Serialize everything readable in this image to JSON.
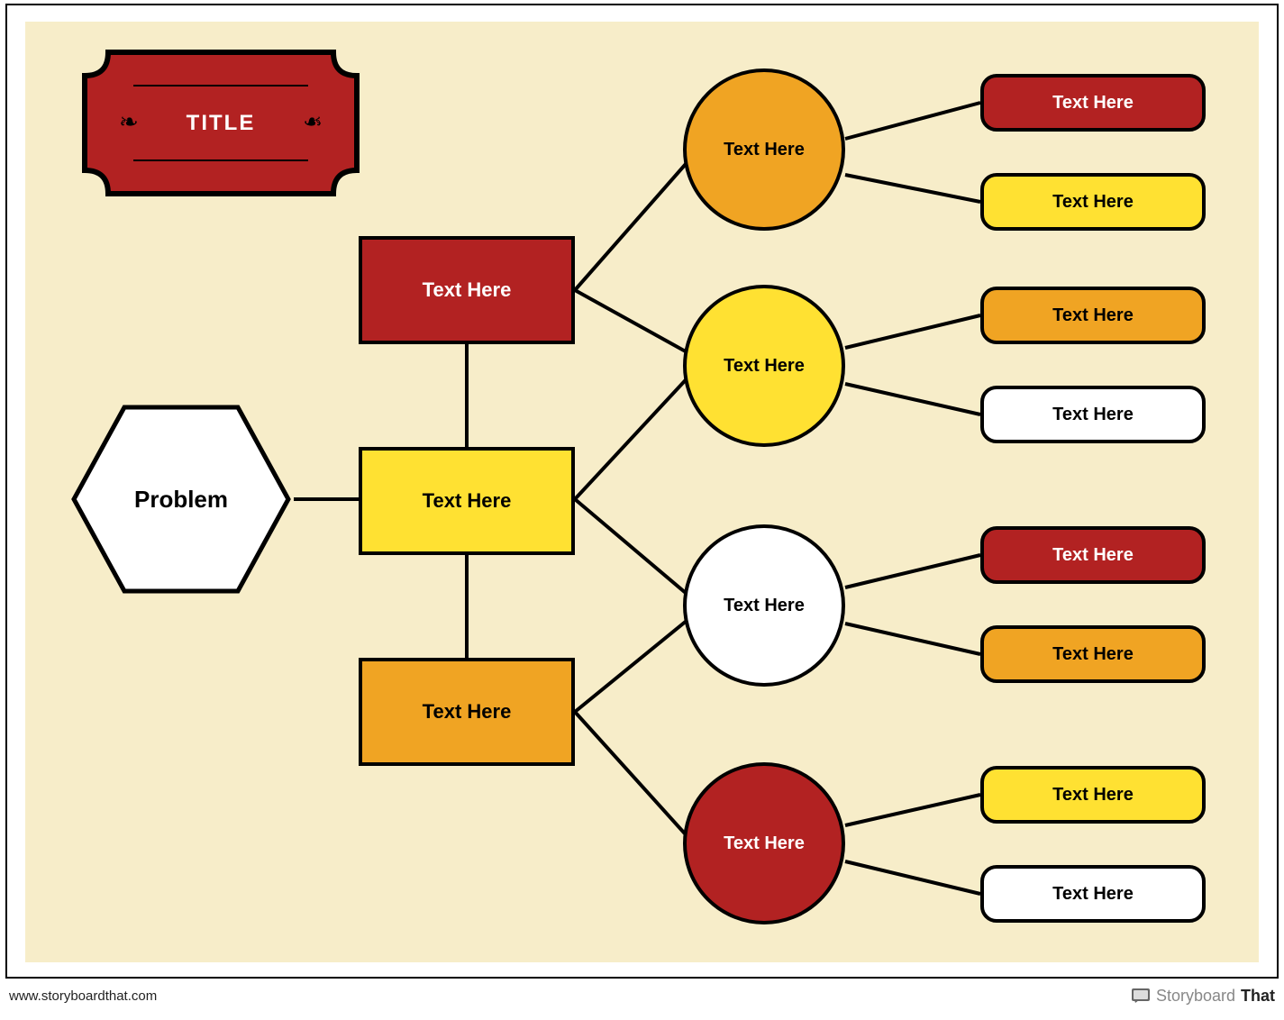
{
  "title": {
    "text": "TITLE"
  },
  "root": {
    "label": "Problem"
  },
  "branches": [
    {
      "label": "Text Here",
      "color": "red"
    },
    {
      "label": "Text Here",
      "color": "yellow"
    },
    {
      "label": "Text Here",
      "color": "orange"
    }
  ],
  "circles": [
    {
      "label": "Text Here",
      "color": "orange"
    },
    {
      "label": "Text Here",
      "color": "yellow"
    },
    {
      "label": "Text Here",
      "color": "white"
    },
    {
      "label": "Text Here",
      "color": "red"
    }
  ],
  "leaves": [
    {
      "label": "Text Here",
      "color": "red"
    },
    {
      "label": "Text Here",
      "color": "yellow"
    },
    {
      "label": "Text Here",
      "color": "orange"
    },
    {
      "label": "Text Here",
      "color": "white"
    },
    {
      "label": "Text Here",
      "color": "red"
    },
    {
      "label": "Text Here",
      "color": "orange"
    },
    {
      "label": "Text Here",
      "color": "yellow"
    },
    {
      "label": "Text Here",
      "color": "white"
    }
  ],
  "footer": {
    "url": "www.storyboardthat.com",
    "brand_thin": "Storyboard",
    "brand_bold": "That"
  },
  "colors": {
    "red": "#b22222",
    "yellow": "#ffe132",
    "orange": "#f0a423",
    "white": "#ffffff",
    "canvas": "#f7edc9"
  }
}
